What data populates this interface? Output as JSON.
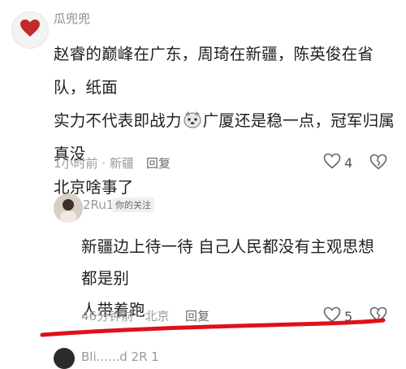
{
  "comment": {
    "username": "瓜兜兜",
    "lines": [
      "赵睿的巅峰在广东，周琦在新疆，陈英俊在省队，纸面",
      "实力不代表即战力",
      "广厦还是稳一点，冠军归属真没",
      "北京啥事了"
    ],
    "meta": "1小时前 · 新疆",
    "reply_label": "回复",
    "likes": "4",
    "avatar_icon": "heart-icon",
    "emoji_icon": "doge-emoji-icon",
    "colors": {
      "heart": "#c42a2a",
      "underline": "#e0101a"
    }
  },
  "reply": {
    "username": "2Ru1",
    "badge": "你的关注",
    "lines": [
      "新疆边上待一待 自己人民都没有主观思想 都是别",
      "人带着跑"
    ],
    "meta": "46分钟前 · 北京",
    "reply_label": "回复",
    "likes": "5"
  },
  "next": {
    "username_partial": "Bli......d 2R 1"
  }
}
